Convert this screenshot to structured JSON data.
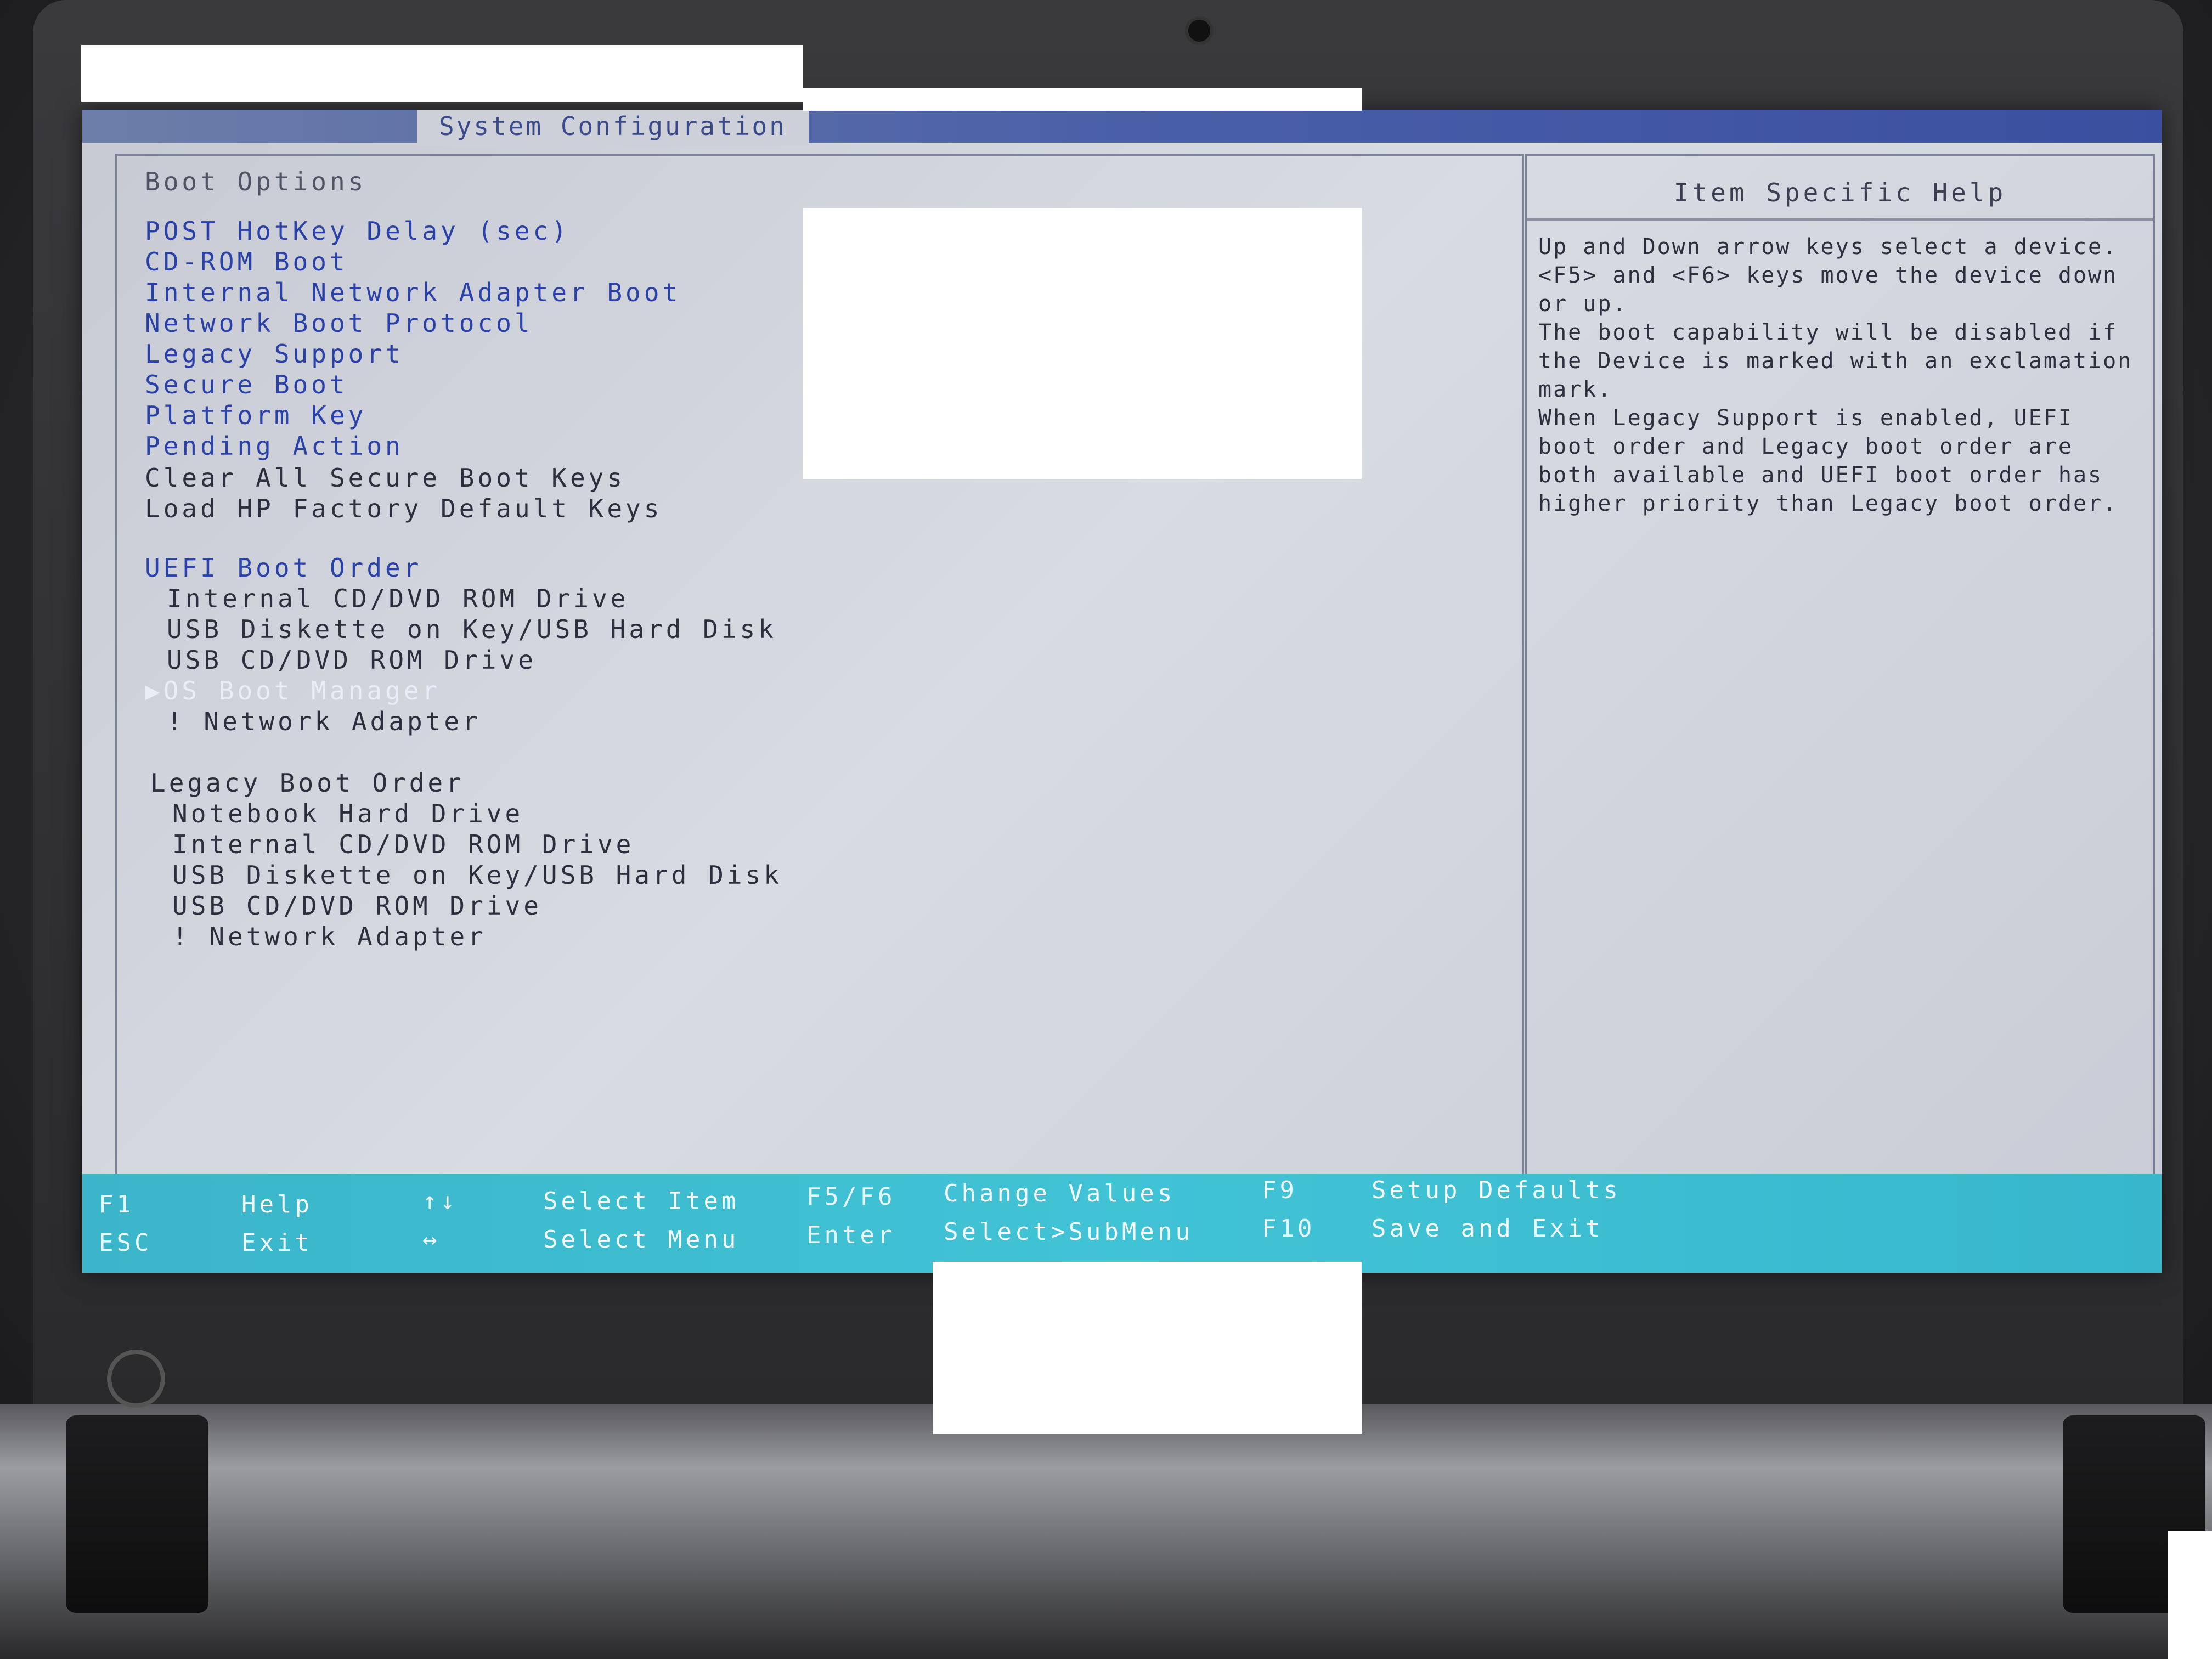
{
  "title": "System Configuration",
  "section_title": "Boot Options",
  "boot_options": [
    "POST HotKey Delay (sec)",
    "CD-ROM Boot",
    "Internal Network Adapter Boot",
    "Network Boot Protocol",
    "Legacy Support",
    "Secure Boot",
    "Platform Key",
    "Pending Action"
  ],
  "actions": [
    "Clear All Secure Boot Keys",
    "Load HP Factory Default Keys"
  ],
  "uefi": {
    "header": "UEFI Boot Order",
    "items": [
      "Internal CD/DVD ROM Drive",
      "USB Diskette on Key/USB Hard Disk",
      "USB CD/DVD ROM Drive",
      "OS Boot Manager",
      "! Network Adapter"
    ],
    "selected_index": 3
  },
  "legacy": {
    "header": "Legacy Boot Order",
    "items": [
      "Notebook Hard Drive",
      "Internal CD/DVD ROM Drive",
      "USB Diskette on Key/USB Hard Disk",
      "USB CD/DVD ROM Drive",
      "! Network Adapter"
    ]
  },
  "help": {
    "title": "Item Specific Help",
    "paragraphs": [
      "Up and Down arrow keys select a device. <F5> and <F6> keys move the device down or up.",
      "The boot capability will be disabled if the Device is marked with an exclamation mark.",
      "When Legacy Support is enabled, UEFI boot order and Legacy boot order are both available and UEFI boot order has higher priority than Legacy boot order."
    ]
  },
  "footer": {
    "f1": "F1",
    "help": "Help",
    "esc": "ESC",
    "exit": "Exit",
    "updown": "↑↓",
    "select_item": "Select Item",
    "leftright": "↔",
    "select_menu": "Select Menu",
    "f5f6": "F5/F6",
    "change_values": "Change Values",
    "enter": "Enter",
    "select_submenu": "Select>SubMenu",
    "f9": "F9",
    "setup_defaults": "Setup Defaults",
    "f10": "F10",
    "save_exit": "Save and Exit"
  },
  "colors": {
    "link": "#2a42a8",
    "footer": "#41c3d6",
    "selected": "#e9edf7"
  }
}
